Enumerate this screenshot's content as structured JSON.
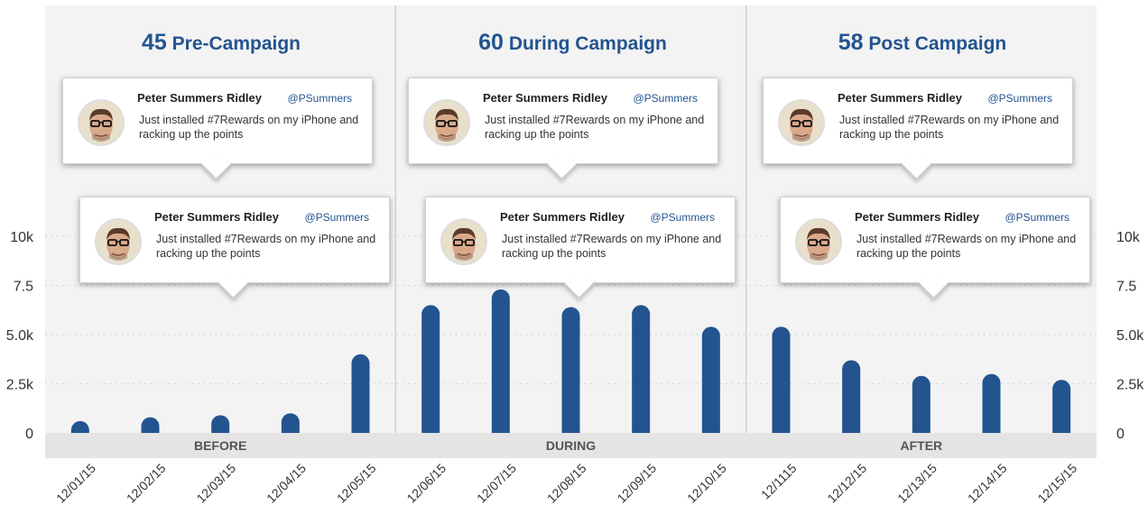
{
  "chart_data": {
    "type": "bar",
    "categories": [
      "12/01/15",
      "12/02/15",
      "12/03/15",
      "12/04/15",
      "12/05/15",
      "12/06/15",
      "12/07/15",
      "12/08/15",
      "12/09/15",
      "12/10/15",
      "12/1115",
      "12/12/15",
      "12/13/15",
      "12/14/15",
      "12/15/15"
    ],
    "series": [
      {
        "values": [
          600,
          800,
          900,
          1000,
          4000,
          6500,
          7300,
          6400,
          6500,
          5400,
          5400,
          3700,
          2900,
          3000,
          2700
        ]
      }
    ],
    "ylim": [
      0,
      10000
    ],
    "y_ticks": [
      {
        "value": 0,
        "label": "0"
      },
      {
        "value": 2500,
        "label": "2.5k"
      },
      {
        "value": 5000,
        "label": "5.0k"
      },
      {
        "value": 7500,
        "label": "7.5"
      },
      {
        "value": 10000,
        "label": "10k"
      }
    ],
    "grid": true,
    "bar_color": "#23548f",
    "panel_color": "#f3f3f3",
    "band_color": "#e4e4e4",
    "phases": [
      {
        "label": "BEFORE",
        "count": "45",
        "title": "Pre-Campaign",
        "first_index": 0,
        "last_index": 4
      },
      {
        "label": "DURING",
        "count": "60",
        "title": "During Campaign",
        "first_index": 5,
        "last_index": 9
      },
      {
        "label": "AFTER",
        "count": "58",
        "title": "Post Campaign",
        "first_index": 10,
        "last_index": 14
      }
    ]
  },
  "tweets": [
    {
      "name": "Peter Summers Ridley",
      "handle": "@PSummers",
      "text": "Just installed #7Rewards on my iPhone and racking up the points"
    },
    {
      "name": "Peter Summers Ridley",
      "handle": "@PSummers",
      "text": "Just installed #7Rewards on my iPhone and racking up the points"
    },
    {
      "name": "Peter Summers Ridley",
      "handle": "@PSummers",
      "text": "Just installed #7Rewards on my iPhone and racking up the points"
    },
    {
      "name": "Peter Summers Ridley",
      "handle": "@PSummers",
      "text": "Just installed #7Rewards on my iPhone and racking up the points"
    },
    {
      "name": "Peter Summers Ridley",
      "handle": "@PSummers",
      "text": "Just installed #7Rewards on my iPhone and racking up the points"
    },
    {
      "name": "Peter Summers Ridley",
      "handle": "@PSummers",
      "text": "Just installed #7Rewards on my iPhone and racking up the points"
    }
  ]
}
